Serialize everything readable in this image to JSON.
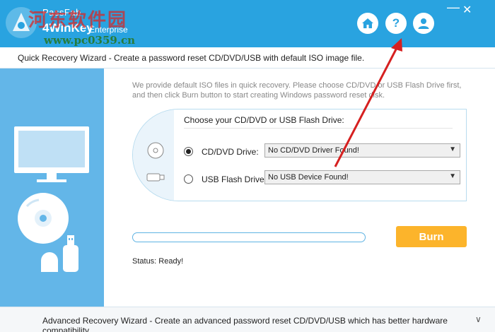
{
  "header": {
    "brand_name": "PassFab",
    "product_name": "4WinKey",
    "edition": "Enterprise",
    "watermark_cn": "河东软件园",
    "watermark_url": "www.pc0359.cn",
    "buttons": [
      "home-icon",
      "help-icon",
      "user-icon"
    ],
    "help_glyph": "?",
    "minimize_glyph": "—",
    "close_glyph": "✕",
    "accent_color": "#29a3e0"
  },
  "wizard": {
    "title": "Quick Recovery Wizard - Create a password reset CD/DVD/USB with default ISO image file."
  },
  "main": {
    "description": "We provide default ISO files in quick recovery. Please choose CD/DVD or USB Flash Drive first, and then click Burn button to start creating Windows password reset disk.",
    "choose_title": "Choose your CD/DVD or USB Flash Drive:",
    "options": [
      {
        "label": "CD/DVD Drive:",
        "selected": true,
        "value": "No CD/DVD Driver Found!"
      },
      {
        "label": "USB Flash Drive:",
        "selected": false,
        "value": "No USB Device Found!"
      }
    ],
    "burn_label": "Burn",
    "burn_color": "#fcb42b",
    "progress_fraction": 0,
    "status": "Status: Ready!"
  },
  "footer": {
    "text": "Advanced Recovery Wizard - Create an advanced password reset CD/DVD/USB which has better hardware compatibility.",
    "chevron": "∨"
  },
  "annotation": {
    "color": "#d62020"
  }
}
